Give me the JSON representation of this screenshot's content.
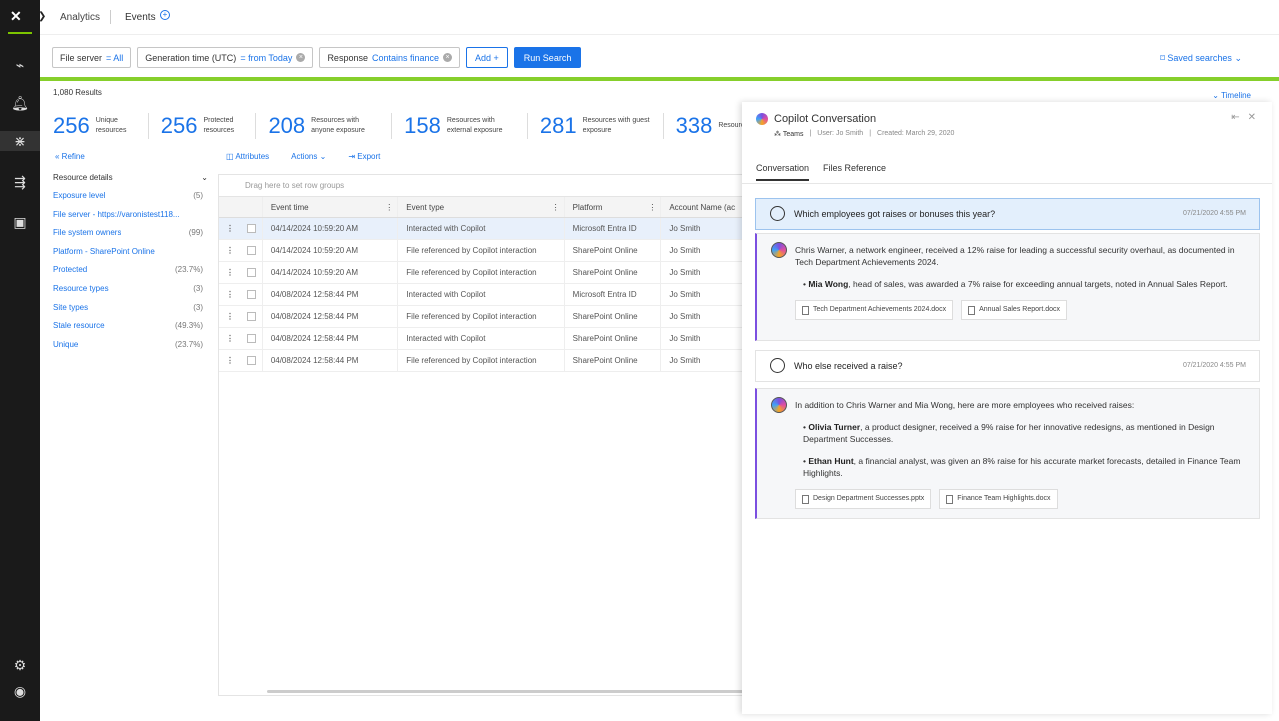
{
  "nav": {
    "analytics": "Analytics",
    "events": "Events",
    "add_tab": "+"
  },
  "filters": [
    {
      "label": "File server",
      "value": "= All",
      "removable": false
    },
    {
      "label": "Generation time (UTC)",
      "value": "= from Today",
      "removable": true
    },
    {
      "label": "Response",
      "value": "Contains finance",
      "removable": true
    }
  ],
  "toolbar": {
    "add_label": "Add +",
    "run_label": "Run Search",
    "saved_label": "Saved searches"
  },
  "results_label": "1,080 Results",
  "timeline_label": "Timeline",
  "stats": [
    {
      "num": "256",
      "label": "Unique resources"
    },
    {
      "num": "256",
      "label": "Protected resources"
    },
    {
      "num": "208",
      "label": "Resources with anyone exposure"
    },
    {
      "num": "158",
      "label": "Resources with external exposure"
    },
    {
      "num": "281",
      "label": "Resources with guest exposure"
    },
    {
      "num": "338",
      "label": "Resources org-wide"
    }
  ],
  "refine": {
    "label": "Refine",
    "section": "Resource details"
  },
  "facets": [
    {
      "name": "Exposure level",
      "count": "(5)"
    },
    {
      "name": "File server - https://varonistest118...",
      "count": ""
    },
    {
      "name": "File system owners",
      "count": "(99)"
    },
    {
      "name": "Platform - SharePoint Online",
      "count": ""
    },
    {
      "name": "Protected",
      "count": "(23.7%)"
    },
    {
      "name": "Resource types",
      "count": "(3)"
    },
    {
      "name": "Site types",
      "count": "(3)"
    },
    {
      "name": "Stale resource",
      "count": "(49.3%)"
    },
    {
      "name": "Unique",
      "count": "(23.7%)"
    }
  ],
  "grid_tools": {
    "attributes": "Attributes",
    "actions": "Actions",
    "export": "Export",
    "rowgroups": "Drag here to set row groups"
  },
  "columns": {
    "time": "Event time",
    "type": "Event type",
    "platform": "Platform",
    "account": "Account Name (ac"
  },
  "rows": [
    {
      "time": "04/14/2024 10:59:20 AM",
      "type": "Interacted with Copilot",
      "platform": "Microsoft Entra ID",
      "account": "Jo Smith"
    },
    {
      "time": "04/14/2024 10:59:20 AM",
      "type": "File referenced by Copilot interaction",
      "platform": "SharePoint Online",
      "account": "Jo Smith"
    },
    {
      "time": "04/14/2024 10:59:20 AM",
      "type": "File referenced by Copilot interaction",
      "platform": "SharePoint Online",
      "account": "Jo Smith"
    },
    {
      "time": "04/08/2024 12:58:44 PM",
      "type": "Interacted with Copilot",
      "platform": "Microsoft Entra ID",
      "account": "Jo Smith"
    },
    {
      "time": "04/08/2024 12:58:44 PM",
      "type": "File referenced by Copilot interaction",
      "platform": "SharePoint Online",
      "account": "Jo Smith"
    },
    {
      "time": "04/08/2024 12:58:44 PM",
      "type": "Interacted with Copilot",
      "platform": "SharePoint Online",
      "account": "Jo Smith"
    },
    {
      "time": "04/08/2024 12:58:44 PM",
      "type": "File referenced by Copilot interaction",
      "platform": "SharePoint Online",
      "account": "Jo Smith"
    }
  ],
  "panel": {
    "title": "Copilot Conversation",
    "app": "Teams",
    "user": "User: Jo Smith",
    "created": "Created: March 29, 2020",
    "tab_conversation": "Conversation",
    "tab_files": "Files Reference",
    "q1": {
      "text": "Which employees got raises or bonuses this year?",
      "ts": "07/21/2020 4:55 PM"
    },
    "a1": {
      "intro": "Chris Warner, a network engineer, received a 12% raise for leading a successful security overhaul, as documented in Tech Department Achievements 2024.",
      "b1_name": "Mia Wong",
      "b1_text": ", head of sales, was awarded a 7% raise for exceeding annual targets, noted in Annual Sales Report.",
      "file1": "Tech Department Achievements 2024.docx",
      "file2": "Annual Sales Report.docx"
    },
    "q2": {
      "text": "Who else received a raise?",
      "ts": "07/21/2020 4:55 PM"
    },
    "a2": {
      "intro": "In addition to Chris Warner and Mia Wong, here are more employees who received raises:",
      "b1_name": "Olivia Turner",
      "b1_text": ", a product designer, received a 9% raise for her innovative redesigns, as mentioned in Design Department Successes.",
      "b2_name": "Ethan Hunt",
      "b2_text": ", a financial analyst, was given an 8% raise for his accurate market forecasts, detailed in Finance Team Highlights.",
      "file1": "Design Department Successes.pptx",
      "file2": "Finance Team Highlights.docx"
    }
  }
}
